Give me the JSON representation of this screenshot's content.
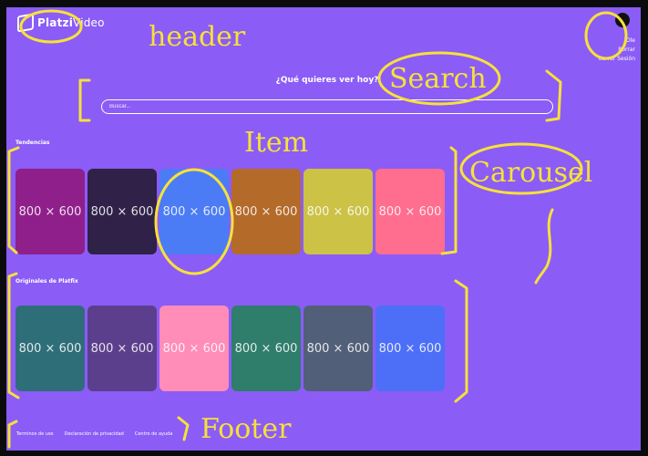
{
  "header": {
    "logo": {
      "text_bold": "Platzi",
      "text_rest": "Video"
    },
    "user_menu": [
      "Ole",
      "Borrar",
      "Cerrar Sesión"
    ]
  },
  "search": {
    "title": "¿Qué quieres ver hoy?",
    "placeholder": "Buscar..."
  },
  "sections": [
    {
      "title": "Tendencias",
      "items": [
        {
          "label": "800 × 600",
          "color": "#8f1f8a"
        },
        {
          "label": "800 × 600",
          "color": "#2f2148"
        },
        {
          "label": "800 × 600",
          "color": "#4b7cf5"
        },
        {
          "label": "800 × 600",
          "color": "#b46a29"
        },
        {
          "label": "800 × 600",
          "color": "#cbc246"
        },
        {
          "label": "800 × 600",
          "color": "#ff6d8f"
        }
      ]
    },
    {
      "title": "Originales de Platfix",
      "items": [
        {
          "label": "800 × 600",
          "color": "#2e6e79"
        },
        {
          "label": "800 × 600",
          "color": "#5c3f8c"
        },
        {
          "label": "800 × 600",
          "color": "#ff8db8"
        },
        {
          "label": "800 × 600",
          "color": "#2f7d6b"
        },
        {
          "label": "800 × 600",
          "color": "#525f78"
        },
        {
          "label": "800 × 600",
          "color": "#4d6ff7"
        }
      ]
    }
  ],
  "footer": {
    "links": [
      "Terminos de uso",
      "Declaración de privacidad",
      "Centro de ayuda"
    ]
  },
  "annotations": {
    "header": "header",
    "search": "Search",
    "item": "Item",
    "carousel": "Carousel",
    "footer": "Footer",
    "color": "#f6e13a"
  }
}
